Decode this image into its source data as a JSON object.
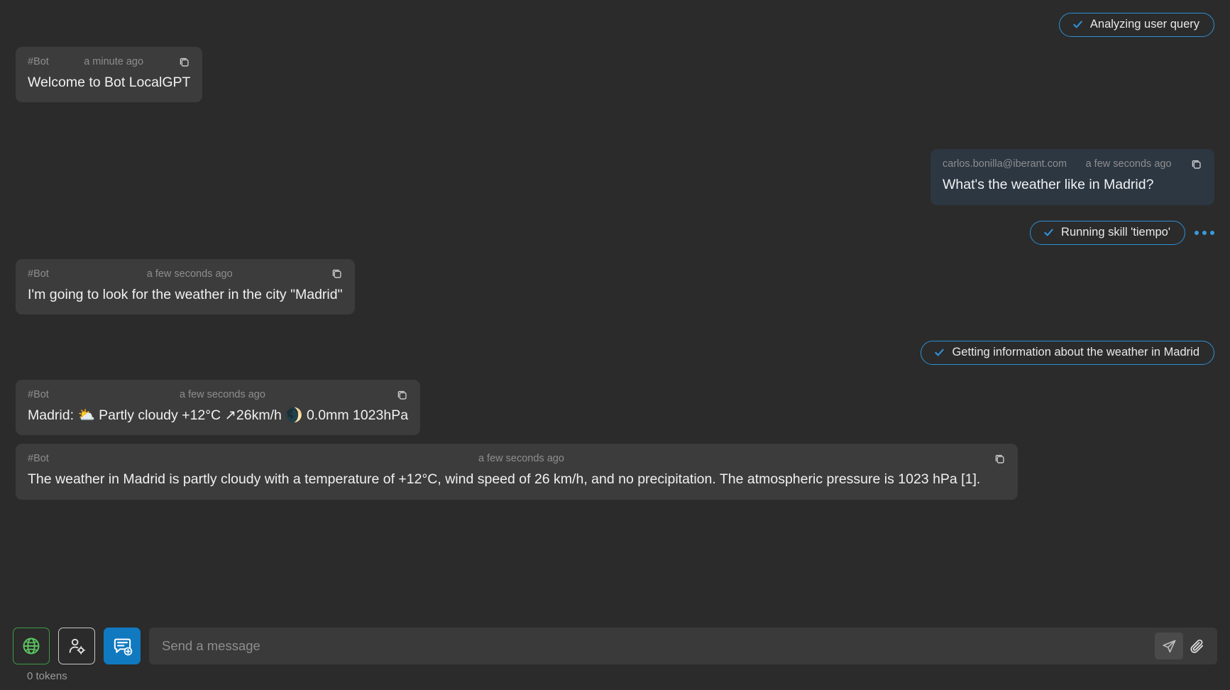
{
  "theme": {
    "page_bg": "#2b2b2b",
    "bot_bubble_bg": "#3c3c3c",
    "user_bubble_bg": "#2c3742",
    "accent_blue": "#2d8fd5",
    "accent_green": "#3f9b46",
    "button_blue": "#1179c0",
    "text_primary": "#f1f1f1",
    "text_muted": "#8e8e8e"
  },
  "conversation": [
    {
      "kind": "status",
      "name": "status-analyzing",
      "label": "Analyzing user query",
      "icon": "check-icon",
      "align": "right",
      "has_menu": false
    },
    {
      "kind": "message",
      "name": "message-welcome",
      "author": "#Bot",
      "timestamp": "a minute ago",
      "text": "Welcome to Bot LocalGPT",
      "align": "left",
      "copy_icon": "copy-icon"
    },
    {
      "kind": "message",
      "name": "message-user-question",
      "author": "carlos.bonilla@iberant.com",
      "timestamp": "a few seconds ago",
      "text": "What's the weather like in Madrid?",
      "align": "right",
      "copy_icon": "copy-icon"
    },
    {
      "kind": "status",
      "name": "status-running-skill",
      "label": "Running skill 'tiempo'",
      "icon": "check-icon",
      "align": "right",
      "has_menu": true,
      "menu_name": "more-options-icon"
    },
    {
      "kind": "message",
      "name": "message-bot-lookup",
      "author": "#Bot",
      "timestamp": "a few seconds ago",
      "text": "I'm going to look for the weather in the city \"Madrid\"",
      "align": "left",
      "copy_icon": "copy-icon"
    },
    {
      "kind": "status",
      "name": "status-getting-info",
      "label": "Getting information about the weather in Madrid",
      "icon": "check-icon",
      "align": "right",
      "has_menu": false
    },
    {
      "kind": "message",
      "name": "message-weather-raw",
      "author": "#Bot",
      "timestamp": "a few seconds ago",
      "text": "Madrid: ⛅ Partly cloudy +12°C ↗26km/h 🌒 0.0mm 1023hPa",
      "align": "left",
      "copy_icon": "copy-icon"
    },
    {
      "kind": "message",
      "name": "message-weather-summary",
      "author": "#Bot",
      "timestamp": "a few seconds ago",
      "text": "The weather in Madrid is partly cloudy with a temperature of +12°C, wind speed of 26 km/h, and no precipitation. The atmospheric pressure is 1023 hPa [1].",
      "align": "left",
      "copy_icon": "copy-icon"
    }
  ],
  "composer": {
    "buttons": [
      {
        "name": "web-search-toggle",
        "icon": "globe-icon",
        "style": "globe"
      },
      {
        "name": "agent-settings-button",
        "icon": "person-gear-icon",
        "style": "agent"
      },
      {
        "name": "new-chat-button",
        "icon": "new-chat-icon",
        "style": "newchat"
      }
    ],
    "input": {
      "name": "message-input",
      "value": "",
      "placeholder": "Send a message"
    },
    "send": {
      "name": "send-button",
      "icon": "send-icon"
    },
    "attach": {
      "name": "attach-button",
      "icon": "paperclip-icon"
    },
    "tokens": "0 tokens"
  }
}
